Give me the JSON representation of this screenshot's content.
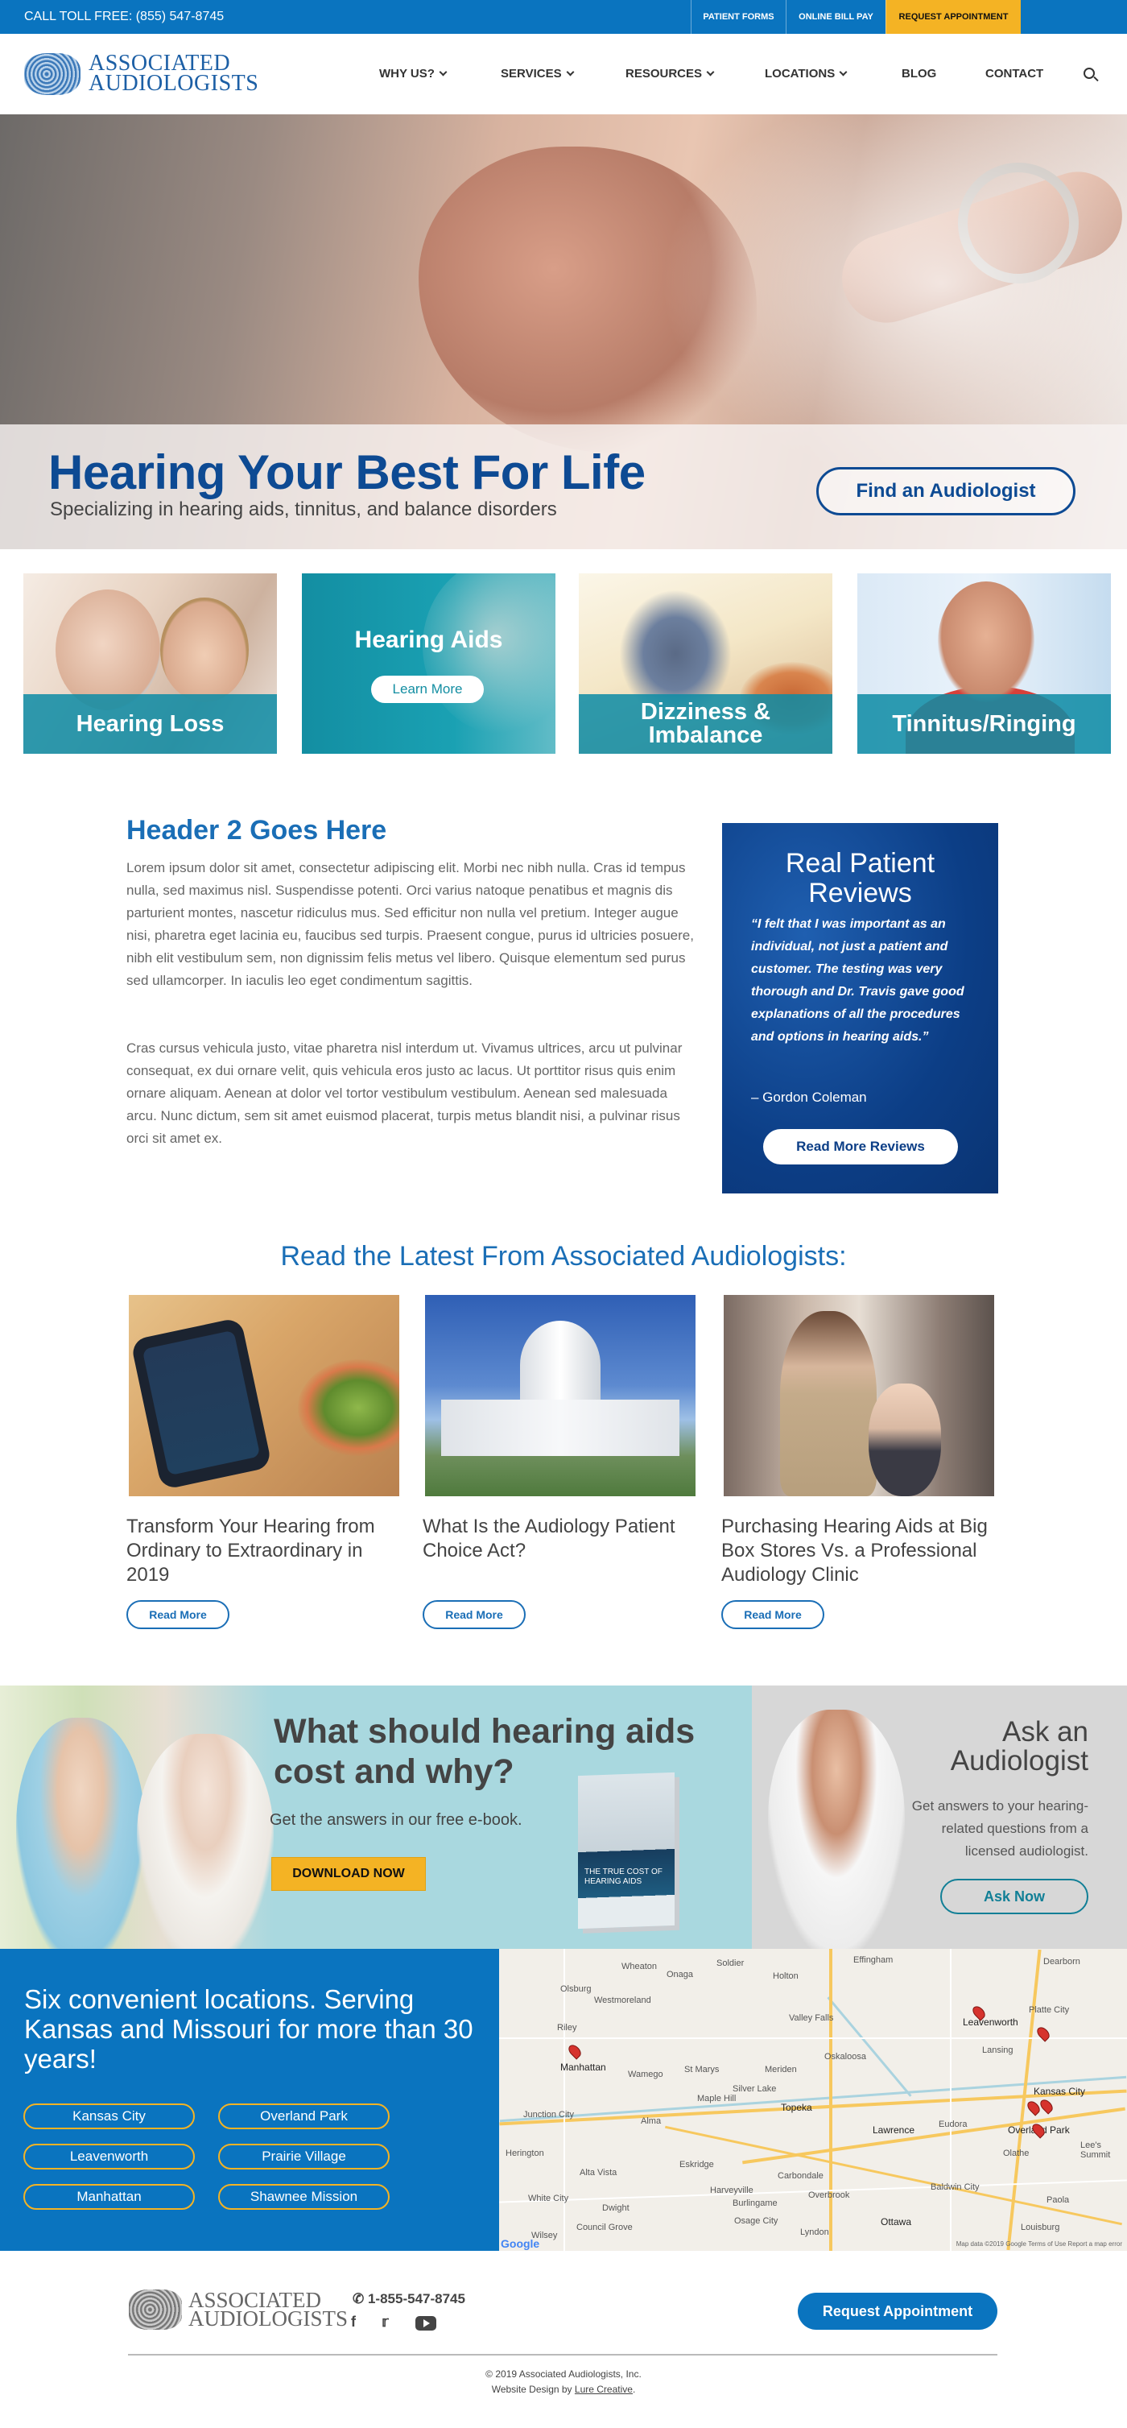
{
  "topbar": {
    "toll_free": "CALL TOLL FREE: (855) 547-8745",
    "patient_forms": "PATIENT FORMS",
    "online_bill_pay": "ONLINE BILL PAY",
    "request_appointment": "REQUEST APPOINTMENT"
  },
  "header": {
    "logo_line1": "ASSOCIATED",
    "logo_line2": "AUDIOLOGISTS",
    "nav": [
      "WHY US?",
      "SERVICES",
      "RESOURCES",
      "LOCATIONS",
      "BLOG",
      "CONTACT"
    ],
    "search_icon": "search-icon"
  },
  "hero": {
    "title": "Hearing Your Best For Life",
    "subtitle": "Specializing in hearing aids, tinnitus, and balance disorders",
    "cta": "Find an Audiologist"
  },
  "tiles": {
    "hearing_loss": "Hearing Loss",
    "hearing_aids": "Hearing Aids",
    "learn_more": "Learn More",
    "dizziness_1": "Dizziness &",
    "dizziness_2": "Imbalance",
    "tinnitus": "Tinnitus/Ringing"
  },
  "content": {
    "heading": "Header 2 Goes Here",
    "para1": "Lorem ipsum dolor sit amet, consectetur adipiscing elit. Morbi nec nibh nulla. Cras id tempus nulla, sed maximus nisl. Suspendisse potenti. Orci varius natoque penatibus et magnis dis parturient montes, nascetur ridiculus mus. Sed efficitur non nulla vel pretium. Integer augue nisi, pharetra eget lacinia eu, faucibus sed turpis. Praesent congue, purus id ultricies posuere, nibh elit vestibulum sem, non dignissim felis metus vel libero. Quisque elementum sed purus sed ullamcorper. In iaculis leo eget condimentum sagittis.",
    "para2": "Cras cursus vehicula justo, vitae pharetra nisl interdum ut. Vivamus ultrices, arcu ut pulvinar consequat, ex dui ornare velit, quis vehicula eros justo ac lacus. Ut porttitor risus quis enim ornare aliquam. Aenean at dolor vel tortor vestibulum vestibulum. Aenean sed malesuada arcu. Nunc dictum, sem sit amet euismod placerat, turpis metus blandit nisi, a pulvinar risus orci sit amet ex."
  },
  "reviews": {
    "title_line1": "Real Patient",
    "title_line2": "Reviews",
    "quote": "“I felt that I was important as an individual, not just a patient and customer. The testing was very thorough and Dr. Travis gave good explanations of all the procedures and options in hearing aids.”",
    "author": "– Gordon Coleman",
    "button": "Read More Reviews"
  },
  "latest": {
    "heading": "Read the Latest From Associated Audiologists:",
    "posts": [
      {
        "title": "Transform Your Hearing from Ordinary to Extraordinary in 2019",
        "button": "Read More"
      },
      {
        "title": "What Is the Audiology Patient Choice Act?",
        "button": "Read More"
      },
      {
        "title": "Purchasing Hearing Aids at Big Box Stores Vs. a Professional Audiology Clinic",
        "button": "Read More"
      }
    ]
  },
  "ebook": {
    "heading": "What should hearing aids cost and why?",
    "subtitle": "Get the answers in our free e-book.",
    "button": "DOWNLOAD NOW",
    "book_title": "THE TRUE COST OF HEARING AIDS"
  },
  "ask": {
    "title_line1": "Ask an",
    "title_line2": "Audiologist",
    "text": "Get answers to your hearing-related questions from a licensed audiologist.",
    "button": "Ask Now"
  },
  "locations": {
    "heading": "Six convenient locations. Serving Kansas and Missouri for more than 30 years!",
    "items": [
      "Kansas City",
      "Overland Park",
      "Leavenworth",
      "Prairie Village",
      "Manhattan",
      "Shawnee Mission"
    ]
  },
  "map": {
    "cities": [
      "Wheaton",
      "Onaga",
      "Soldier",
      "Holton",
      "Effingham",
      "Dearborn",
      "Olsburg",
      "Westmoreland",
      "Valley Falls",
      "Leavenworth",
      "Platte City",
      "Riley",
      "Manhattan",
      "Wamego",
      "St Marys",
      "Meriden",
      "Oskaloosa",
      "Lansing",
      "Kansas City",
      "Topeka",
      "Lawrence",
      "Overland Park",
      "Lee's Summit",
      "Junction City",
      "Alma",
      "Maple Hill",
      "Silver Lake",
      "Eudora",
      "Olathe",
      "Eskridge",
      "Carbondale",
      "Baldwin City",
      "Council Grove",
      "Burlingame",
      "Overbrook",
      "Ottawa",
      "Louisburg",
      "Wilsey",
      "Osage City",
      "Lyndon",
      "Harveyville",
      "White City",
      "Alta Vista",
      "Herington",
      "Dwight",
      "Paola"
    ],
    "google": "Google",
    "map_data": "Map data ©2019 Google   Terms of Use   Report a map error"
  },
  "footer": {
    "logo_line1": "ASSOCIATED",
    "logo_line2": "AUDIOLOGISTS",
    "phone": "1-855-547-8745",
    "request": "Request Appointment",
    "copyright": "© 2019 Associated Audiologists, Inc.",
    "design_prefix": "Website Design by ",
    "design_link": "Lure Creative",
    "design_suffix": "."
  },
  "colors": {
    "brand_blue": "#0a74bf",
    "dark_blue": "#0d4a93",
    "teal": "#0e8ca5",
    "gold": "#f4b324"
  }
}
